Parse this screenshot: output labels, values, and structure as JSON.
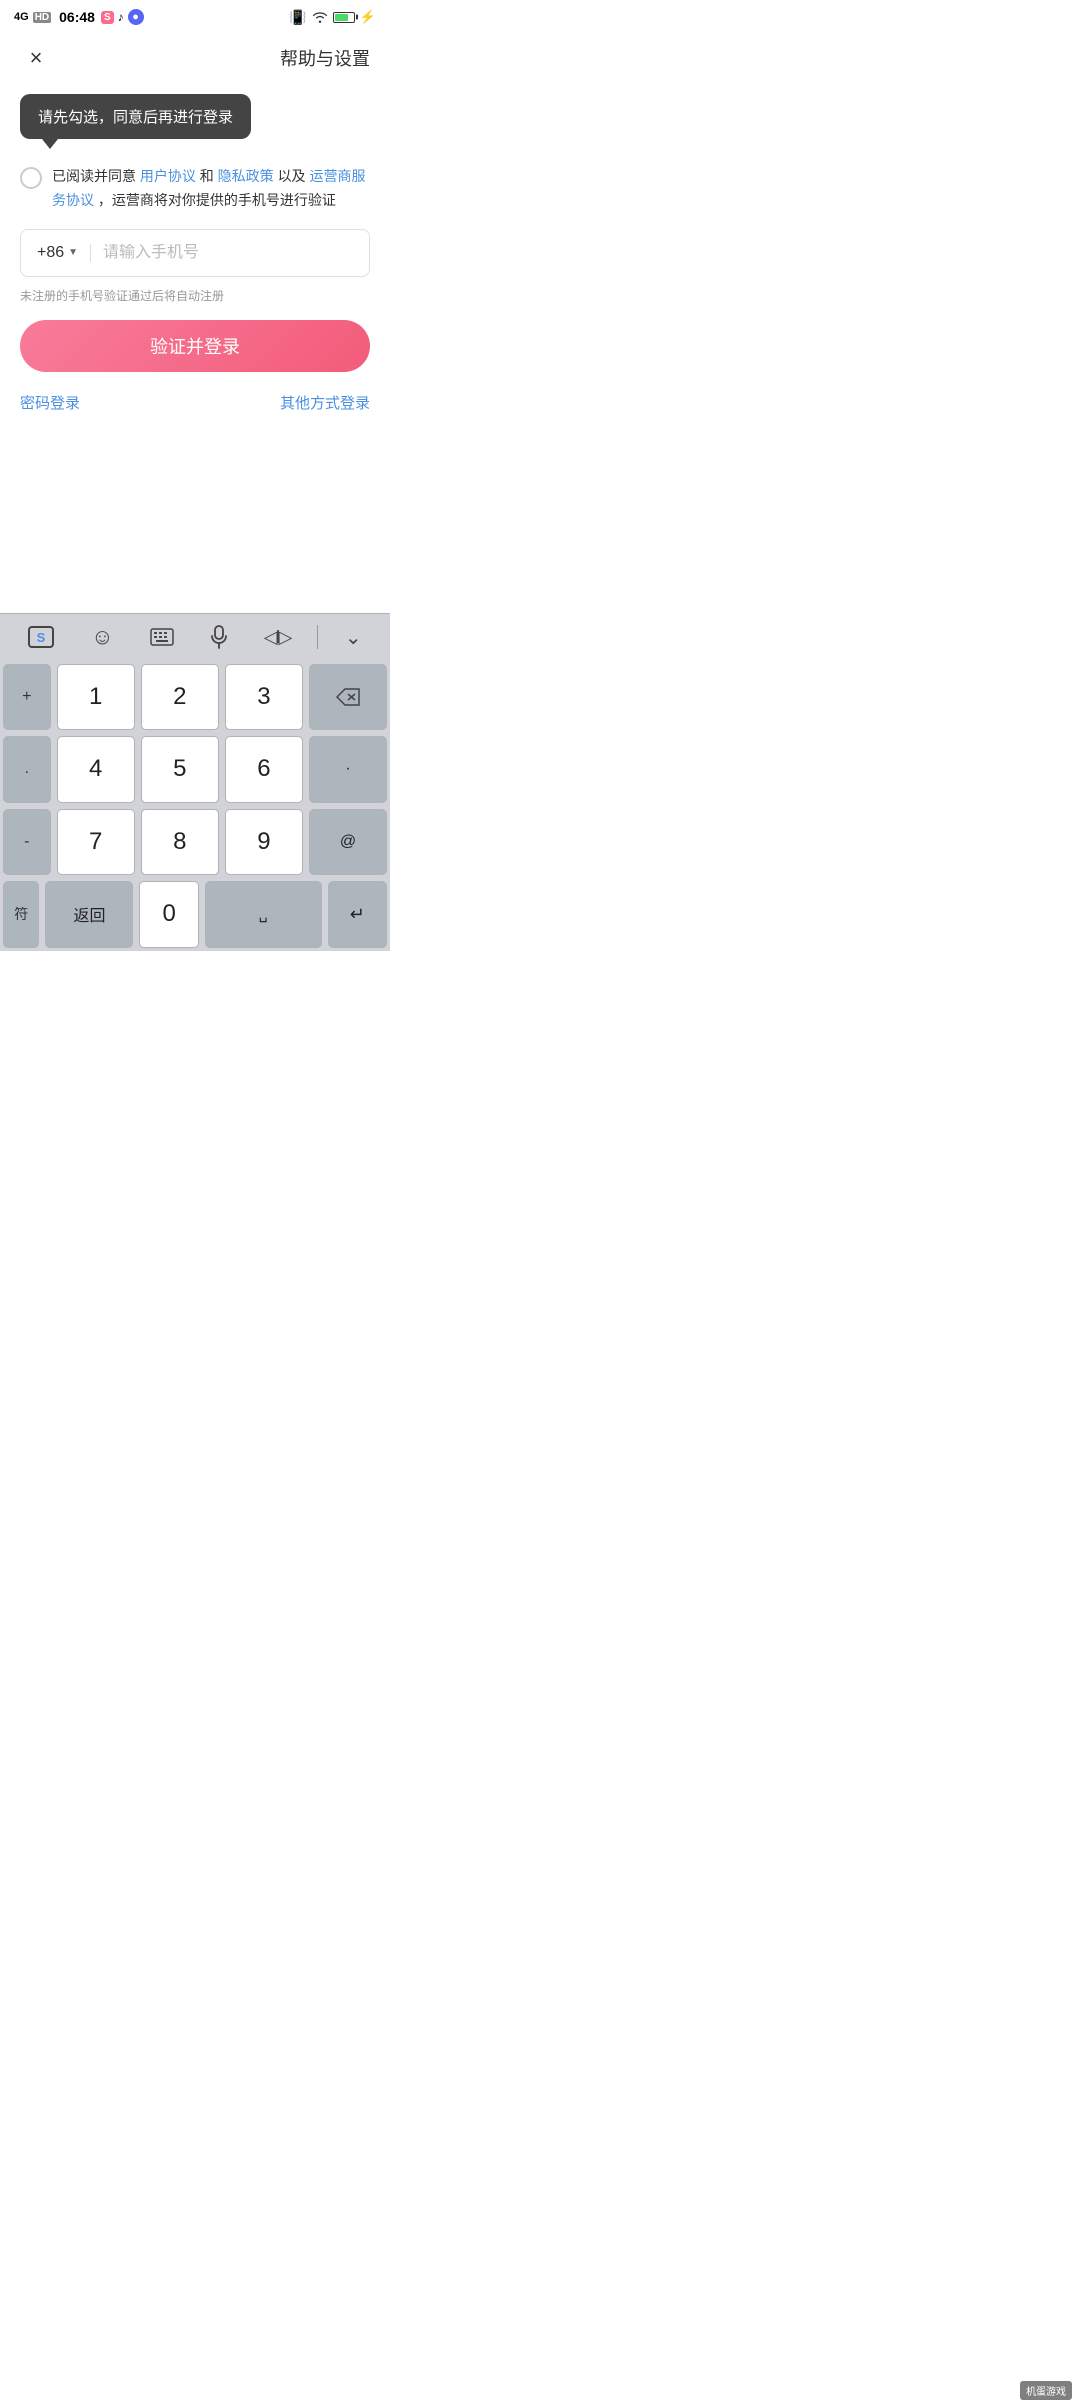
{
  "statusBar": {
    "time": "06:48",
    "network": "4G",
    "hd": "HD"
  },
  "nav": {
    "title": "帮助与设置",
    "closeLabel": "×"
  },
  "tooltip": {
    "text": "请先勾选，同意后再进行登录"
  },
  "agreement": {
    "text1": "已阅读并同意 ",
    "link1": "用户协议",
    "text2": " 和 ",
    "link2": "隐私政策",
    "text3": " 以及 ",
    "link3": "运营商服务协议",
    "text4": "，运营商将对你提供的手机号进行验证"
  },
  "phoneInput": {
    "countryCode": "+86",
    "placeholder": "请输入手机号"
  },
  "hintText": "未注册的手机号验证通过后将自动注册",
  "verifyButton": "验证并登录",
  "links": {
    "password": "密码登录",
    "other": "其他方式登录"
  },
  "keyboard": {
    "toolbarButtons": [
      "S",
      "☺",
      "⌨",
      "🎤",
      "◁I▷",
      "∨"
    ],
    "keys": [
      [
        "+",
        "1",
        "2",
        "3",
        "⌫"
      ],
      [
        ".",
        "4",
        "5",
        "6",
        "·"
      ],
      [
        "-",
        "7",
        "8",
        "9",
        "@"
      ],
      [
        "符",
        "返回",
        "0",
        "␣",
        "↵"
      ]
    ]
  },
  "watermark": "机蛋游戏"
}
